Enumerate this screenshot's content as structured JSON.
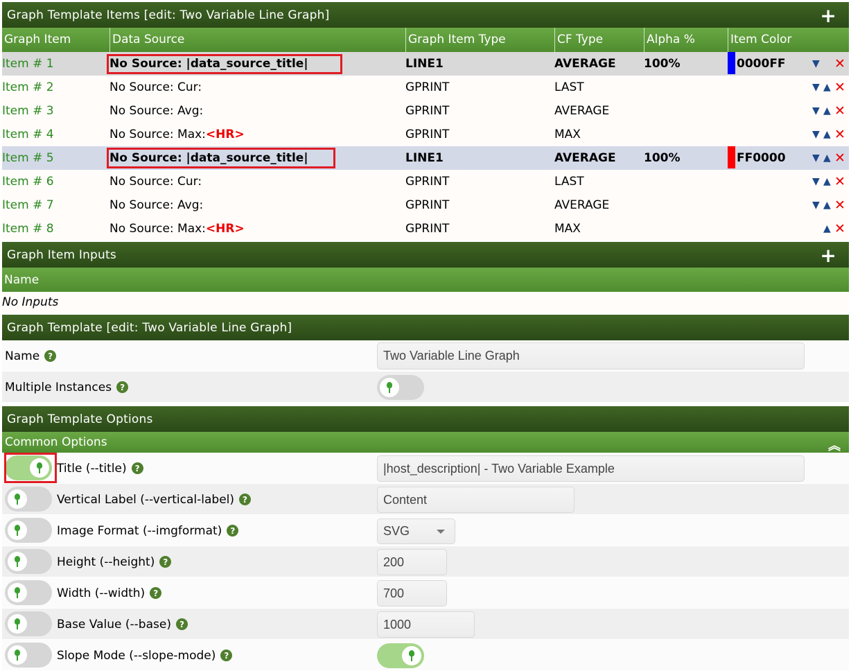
{
  "items_section": {
    "title": "Graph Template Items [edit: Two Variable Line Graph]",
    "add_icon": "+",
    "columns": [
      "Graph Item",
      "Data Source",
      "Graph Item Type",
      "CF Type",
      "Alpha %",
      "Item Color"
    ],
    "rows": [
      {
        "item": "Item # 1",
        "src": "No Source: |data_source_title|",
        "hr": "",
        "type": "LINE1",
        "cf": "AVERAGE",
        "alpha": "100%",
        "color_hex": "0000FF",
        "color": "#0000FF"
      },
      {
        "item": "Item # 2",
        "src": "No Source: Cur:",
        "hr": "",
        "type": "GPRINT",
        "cf": "LAST",
        "alpha": "",
        "color_hex": "",
        "color": ""
      },
      {
        "item": "Item # 3",
        "src": "No Source: Avg:",
        "hr": "",
        "type": "GPRINT",
        "cf": "AVERAGE",
        "alpha": "",
        "color_hex": "",
        "color": ""
      },
      {
        "item": "Item # 4",
        "src": "No Source: Max:",
        "hr": "<HR>",
        "type": "GPRINT",
        "cf": "MAX",
        "alpha": "",
        "color_hex": "",
        "color": ""
      },
      {
        "item": "Item # 5",
        "src": "No Source: |data_source_title|",
        "hr": "",
        "type": "LINE1",
        "cf": "AVERAGE",
        "alpha": "100%",
        "color_hex": "FF0000",
        "color": "#FF0000"
      },
      {
        "item": "Item # 6",
        "src": "No Source: Cur:",
        "hr": "",
        "type": "GPRINT",
        "cf": "LAST",
        "alpha": "",
        "color_hex": "",
        "color": ""
      },
      {
        "item": "Item # 7",
        "src": "No Source: Avg:",
        "hr": "",
        "type": "GPRINT",
        "cf": "AVERAGE",
        "alpha": "",
        "color_hex": "",
        "color": ""
      },
      {
        "item": "Item # 8",
        "src": "No Source: Max:",
        "hr": "<HR>",
        "type": "GPRINT",
        "cf": "MAX",
        "alpha": "",
        "color_hex": "",
        "color": ""
      }
    ]
  },
  "inputs_section": {
    "title": "Graph Item Inputs",
    "add_icon": "+",
    "column": "Name",
    "empty": "No Inputs"
  },
  "template_section": {
    "title": "Graph Template [edit: Two Variable Line Graph]",
    "name_label": "Name",
    "name_value": "Two Variable Line Graph",
    "multi_label": "Multiple Instances"
  },
  "options_section": {
    "title": "Graph Template Options",
    "common": "Common Options",
    "collapse_icon": "double-chevron-up-icon",
    "fields": [
      {
        "label": "Title (--title)",
        "value": "|host_description| - Two Variable Example"
      },
      {
        "label": "Vertical Label (--vertical-label)",
        "value": "Content"
      },
      {
        "label": "Image Format (--imgformat)",
        "value": "SVG"
      },
      {
        "label": "Height (--height)",
        "value": "200"
      },
      {
        "label": "Width (--width)",
        "value": "700"
      },
      {
        "label": "Base Value (--base)",
        "value": "1000"
      },
      {
        "label": "Slope Mode (--slope-mode)",
        "value": ""
      }
    ]
  },
  "help_glyph": "?"
}
